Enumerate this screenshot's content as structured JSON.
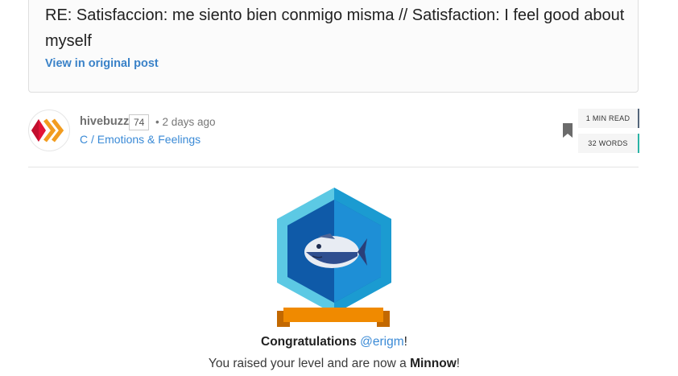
{
  "parent_post": {
    "title": "RE: Satisfaccion: me siento bien conmigo misma // Satisfaction: I feel good about myself",
    "link_label": "View in original post"
  },
  "author": {
    "name": "hivebuzz",
    "reputation": "74",
    "time_ago": "• 2 days ago",
    "community": "C / Emotions & Feelings",
    "avatar_icon": "hivebuzz-logo-icon"
  },
  "stats": {
    "read_time": "1 MIN READ",
    "word_count": "32 WORDS"
  },
  "badge": {
    "icon": "minnow-fish-icon",
    "colors": {
      "hex_outer": "#5cc9e4",
      "hex_inner": "#0f5aa8",
      "ribbon": "#f08a00"
    }
  },
  "message": {
    "congrats_prefix": "Congratulations ",
    "username": "@erigm",
    "congrats_suffix": "!",
    "level_prefix": "You raised your level and are now a ",
    "level_name": "Minnow",
    "level_suffix": "!"
  },
  "colors": {
    "link": "#3a8ad6",
    "read_accent": "#54657a",
    "words_accent": "#2ab3a6"
  }
}
